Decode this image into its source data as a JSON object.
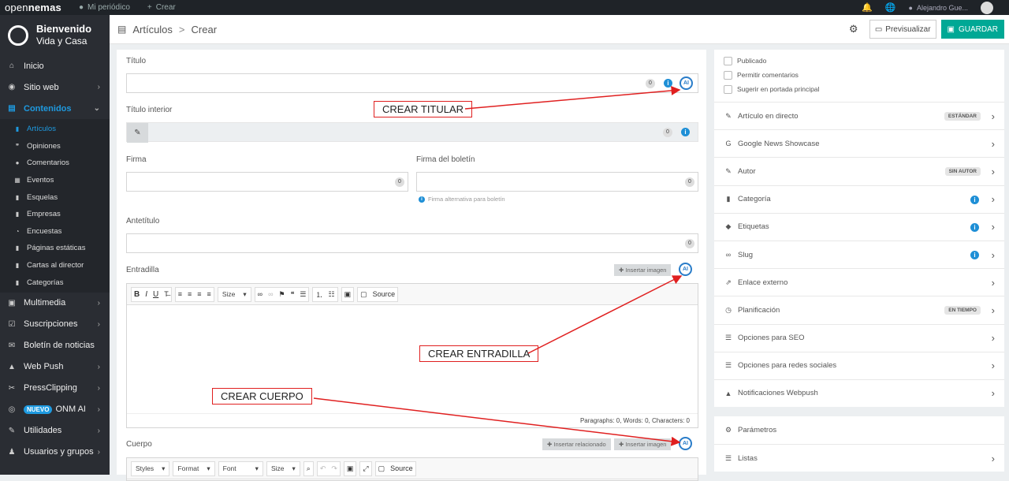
{
  "topbar": {
    "logo_a": "open",
    "logo_b": "nemas",
    "site": "Mi periódico",
    "create": "Crear",
    "user": "Alejandro Gue..."
  },
  "sidebar": {
    "welcome": "Bienvenido",
    "site_name": "Vida y Casa",
    "items": [
      {
        "label": "Inicio",
        "icon": "home-icon"
      },
      {
        "label": "Sitio web",
        "icon": "globe-icon",
        "chevron": true
      },
      {
        "label": "Contenidos",
        "icon": "contents-icon",
        "chevron": true,
        "active": true
      }
    ],
    "sub": [
      {
        "label": "Artículos",
        "icon": "file-icon",
        "active": true
      },
      {
        "label": "Opiniones",
        "icon": "quote-icon"
      },
      {
        "label": "Comentarios",
        "icon": "comment-icon"
      },
      {
        "label": "Eventos",
        "icon": "calendar-icon"
      },
      {
        "label": "Esquelas",
        "icon": "file-icon"
      },
      {
        "label": "Empresas",
        "icon": "building-icon"
      },
      {
        "label": "Encuestas",
        "icon": "pie-icon"
      },
      {
        "label": "Páginas estáticas",
        "icon": "file-icon"
      },
      {
        "label": "Cartas al director",
        "icon": "file-icon"
      },
      {
        "label": "Categorías",
        "icon": "bookmark-icon"
      }
    ],
    "items2": [
      {
        "label": "Multimedia",
        "icon": "media-icon",
        "chevron": true
      },
      {
        "label": "Suscripciones",
        "icon": "check-icon",
        "chevron": true
      },
      {
        "label": "Boletín de noticias",
        "icon": "envelope-icon"
      },
      {
        "label": "Web Push",
        "icon": "bell-icon",
        "chevron": true
      },
      {
        "label": "PressClipping",
        "icon": "clip-icon",
        "chevron": true
      },
      {
        "label": "ONM AI",
        "icon": "ai-icon",
        "chevron": true,
        "badge": "NUEVO"
      },
      {
        "label": "Utilidades",
        "icon": "wrench-icon",
        "chevron": true
      },
      {
        "label": "Usuarios y grupos",
        "icon": "users-icon",
        "chevron": true
      }
    ]
  },
  "header": {
    "section": "Artículos",
    "sep": ">",
    "page": "Crear",
    "preview": "Previsualizar",
    "save": "GUARDAR"
  },
  "form": {
    "titulo": "Título",
    "titulo_count": "0",
    "titulo_interior": "Título interior",
    "titulo_interior_count": "0",
    "firma": "Firma",
    "firma_count": "0",
    "firma_boletin": "Firma del boletín",
    "firma_boletin_count": "0",
    "firma_hint": "Firma alternativa para boletín",
    "antetitulo": "Antetítulo",
    "antetitulo_count": "0",
    "entradilla": "Entradilla",
    "insert_image": "Insertar imagen",
    "entradilla_status": "Paragraphs: 0, Words: 0, Characters: 0",
    "cuerpo": "Cuerpo",
    "insert_related": "Insertar relacionado",
    "ai_label": "AI",
    "tb_size": "Size",
    "tb_source": "Source",
    "tb_styles": "Styles",
    "tb_format": "Format",
    "tb_font": "Font"
  },
  "callouts": {
    "titular": "CREAR TITULAR",
    "entradilla": "CREAR ENTRADILLA",
    "cuerpo": "CREAR CUERPO"
  },
  "rpanel": {
    "checks": [
      "Publicado",
      "Permitir comentarios",
      "Sugerir en portada principal"
    ],
    "items": [
      {
        "label": "Artículo en directo",
        "icon": "edit-icon",
        "badge": "ESTÁNDAR"
      },
      {
        "label": "Google News Showcase",
        "icon": "google-icon"
      },
      {
        "label": "Autor",
        "icon": "edit-icon",
        "badge": "SIN AUTOR"
      },
      {
        "label": "Categoría",
        "icon": "bookmark-icon",
        "info": true
      },
      {
        "label": "Etiquetas",
        "icon": "tag-icon",
        "info": true
      },
      {
        "label": "Slug",
        "icon": "link-icon",
        "info": true
      },
      {
        "label": "Enlace externo",
        "icon": "external-link-icon"
      },
      {
        "label": "Planificación",
        "icon": "clock-icon",
        "badge": "EN TIEMPO"
      },
      {
        "label": "Opciones para SEO",
        "icon": "list-icon"
      },
      {
        "label": "Opciones para redes sociales",
        "icon": "list-icon"
      },
      {
        "label": "Notificaciones Webpush",
        "icon": "bell-icon"
      }
    ],
    "params": "Parámetros",
    "listas": "Listas"
  }
}
